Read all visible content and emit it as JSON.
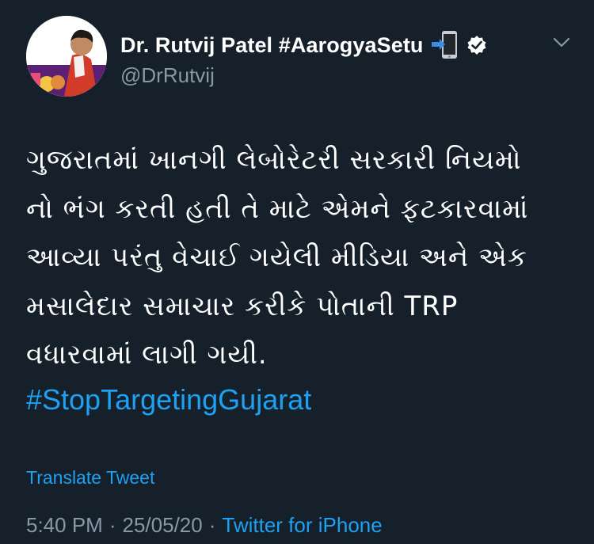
{
  "author": {
    "display_name": "Dr. Rutvij Patel #AarogyaSetu",
    "handle": "@DrRutvij",
    "avatar_icon": "profile-photo",
    "verified_icon": "verified-badge-icon",
    "phone_icon": "mobile-phone-arrow-icon"
  },
  "menu": {
    "icon": "chevron-down-icon"
  },
  "tweet": {
    "lines": [
      "ગુજરાતમાં ખાનગી લેબોરેટરી સરકારી નિયમો",
      "નો ભંગ કરતી હતી તે માટે એમને ફટકારવામાં",
      "આવ્યા પરંતુ વેચાઈ ગયેલી મીડિયા અને એક",
      "મસાલેદાર સમાચાર કરીકે પોતાની TRP",
      "વધારવામાં લાગી ગયી."
    ],
    "hashtag": "#StopTargetingGujarat"
  },
  "translate_label": "Translate Tweet",
  "meta": {
    "time": "5:40 PM",
    "date": "25/05/20",
    "separator": "·",
    "source": "Twitter for iPhone"
  },
  "colors": {
    "background": "#15202b",
    "accent": "#1da1f2",
    "secondary_text": "#8899a6"
  }
}
